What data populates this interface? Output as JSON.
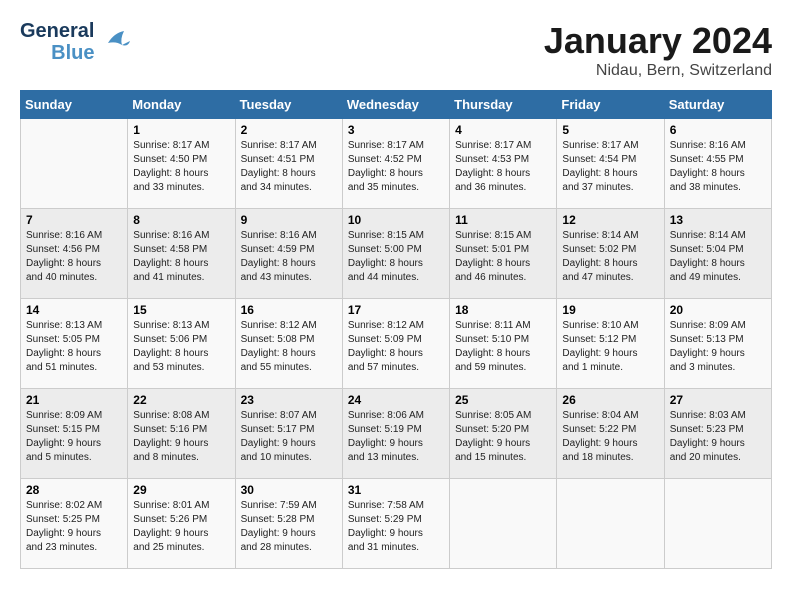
{
  "header": {
    "logo_general": "General",
    "logo_blue": "Blue",
    "month_title": "January 2024",
    "location": "Nidau, Bern, Switzerland"
  },
  "days_of_week": [
    "Sunday",
    "Monday",
    "Tuesday",
    "Wednesday",
    "Thursday",
    "Friday",
    "Saturday"
  ],
  "weeks": [
    [
      {
        "day": "",
        "info": ""
      },
      {
        "day": "1",
        "info": "Sunrise: 8:17 AM\nSunset: 4:50 PM\nDaylight: 8 hours\nand 33 minutes."
      },
      {
        "day": "2",
        "info": "Sunrise: 8:17 AM\nSunset: 4:51 PM\nDaylight: 8 hours\nand 34 minutes."
      },
      {
        "day": "3",
        "info": "Sunrise: 8:17 AM\nSunset: 4:52 PM\nDaylight: 8 hours\nand 35 minutes."
      },
      {
        "day": "4",
        "info": "Sunrise: 8:17 AM\nSunset: 4:53 PM\nDaylight: 8 hours\nand 36 minutes."
      },
      {
        "day": "5",
        "info": "Sunrise: 8:17 AM\nSunset: 4:54 PM\nDaylight: 8 hours\nand 37 minutes."
      },
      {
        "day": "6",
        "info": "Sunrise: 8:16 AM\nSunset: 4:55 PM\nDaylight: 8 hours\nand 38 minutes."
      }
    ],
    [
      {
        "day": "7",
        "info": "Sunrise: 8:16 AM\nSunset: 4:56 PM\nDaylight: 8 hours\nand 40 minutes."
      },
      {
        "day": "8",
        "info": "Sunrise: 8:16 AM\nSunset: 4:58 PM\nDaylight: 8 hours\nand 41 minutes."
      },
      {
        "day": "9",
        "info": "Sunrise: 8:16 AM\nSunset: 4:59 PM\nDaylight: 8 hours\nand 43 minutes."
      },
      {
        "day": "10",
        "info": "Sunrise: 8:15 AM\nSunset: 5:00 PM\nDaylight: 8 hours\nand 44 minutes."
      },
      {
        "day": "11",
        "info": "Sunrise: 8:15 AM\nSunset: 5:01 PM\nDaylight: 8 hours\nand 46 minutes."
      },
      {
        "day": "12",
        "info": "Sunrise: 8:14 AM\nSunset: 5:02 PM\nDaylight: 8 hours\nand 47 minutes."
      },
      {
        "day": "13",
        "info": "Sunrise: 8:14 AM\nSunset: 5:04 PM\nDaylight: 8 hours\nand 49 minutes."
      }
    ],
    [
      {
        "day": "14",
        "info": "Sunrise: 8:13 AM\nSunset: 5:05 PM\nDaylight: 8 hours\nand 51 minutes."
      },
      {
        "day": "15",
        "info": "Sunrise: 8:13 AM\nSunset: 5:06 PM\nDaylight: 8 hours\nand 53 minutes."
      },
      {
        "day": "16",
        "info": "Sunrise: 8:12 AM\nSunset: 5:08 PM\nDaylight: 8 hours\nand 55 minutes."
      },
      {
        "day": "17",
        "info": "Sunrise: 8:12 AM\nSunset: 5:09 PM\nDaylight: 8 hours\nand 57 minutes."
      },
      {
        "day": "18",
        "info": "Sunrise: 8:11 AM\nSunset: 5:10 PM\nDaylight: 8 hours\nand 59 minutes."
      },
      {
        "day": "19",
        "info": "Sunrise: 8:10 AM\nSunset: 5:12 PM\nDaylight: 9 hours\nand 1 minute."
      },
      {
        "day": "20",
        "info": "Sunrise: 8:09 AM\nSunset: 5:13 PM\nDaylight: 9 hours\nand 3 minutes."
      }
    ],
    [
      {
        "day": "21",
        "info": "Sunrise: 8:09 AM\nSunset: 5:15 PM\nDaylight: 9 hours\nand 5 minutes."
      },
      {
        "day": "22",
        "info": "Sunrise: 8:08 AM\nSunset: 5:16 PM\nDaylight: 9 hours\nand 8 minutes."
      },
      {
        "day": "23",
        "info": "Sunrise: 8:07 AM\nSunset: 5:17 PM\nDaylight: 9 hours\nand 10 minutes."
      },
      {
        "day": "24",
        "info": "Sunrise: 8:06 AM\nSunset: 5:19 PM\nDaylight: 9 hours\nand 13 minutes."
      },
      {
        "day": "25",
        "info": "Sunrise: 8:05 AM\nSunset: 5:20 PM\nDaylight: 9 hours\nand 15 minutes."
      },
      {
        "day": "26",
        "info": "Sunrise: 8:04 AM\nSunset: 5:22 PM\nDaylight: 9 hours\nand 18 minutes."
      },
      {
        "day": "27",
        "info": "Sunrise: 8:03 AM\nSunset: 5:23 PM\nDaylight: 9 hours\nand 20 minutes."
      }
    ],
    [
      {
        "day": "28",
        "info": "Sunrise: 8:02 AM\nSunset: 5:25 PM\nDaylight: 9 hours\nand 23 minutes."
      },
      {
        "day": "29",
        "info": "Sunrise: 8:01 AM\nSunset: 5:26 PM\nDaylight: 9 hours\nand 25 minutes."
      },
      {
        "day": "30",
        "info": "Sunrise: 7:59 AM\nSunset: 5:28 PM\nDaylight: 9 hours\nand 28 minutes."
      },
      {
        "day": "31",
        "info": "Sunrise: 7:58 AM\nSunset: 5:29 PM\nDaylight: 9 hours\nand 31 minutes."
      },
      {
        "day": "",
        "info": ""
      },
      {
        "day": "",
        "info": ""
      },
      {
        "day": "",
        "info": ""
      }
    ]
  ]
}
